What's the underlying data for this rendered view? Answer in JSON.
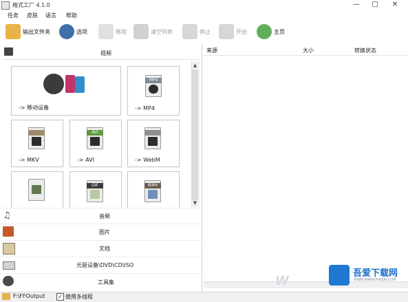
{
  "app": {
    "title": "格式工厂 4.1.0"
  },
  "window": {
    "minimize": "—",
    "maximize": "□",
    "close": "✕"
  },
  "menu": [
    "任务",
    "皮肤",
    "语言",
    "帮助"
  ],
  "toolbar": [
    {
      "label": "输出文件夹",
      "icon": "output-folder-icon",
      "enabled": true
    },
    {
      "label": "选项",
      "icon": "options-icon",
      "enabled": true
    },
    {
      "label": "移除",
      "icon": "remove-icon",
      "enabled": false
    },
    {
      "label": "清空列表",
      "icon": "clear-list-icon",
      "enabled": false
    },
    {
      "label": "停止",
      "icon": "stop-icon",
      "enabled": false
    },
    {
      "label": "开始",
      "icon": "start-icon",
      "enabled": false
    },
    {
      "label": "主页",
      "icon": "home-icon",
      "enabled": true
    }
  ],
  "video_section": {
    "label": "视频"
  },
  "tiles": [
    {
      "label": "-> 移动设备",
      "icon": "mobile-device-icon"
    },
    {
      "label": "-> MP4",
      "icon": "mp4-file-icon",
      "tag": "MP4"
    },
    {
      "label": "-> MKV",
      "icon": "mkv-file-icon",
      "tag": ""
    },
    {
      "label": "-> AVI",
      "icon": "avi-file-icon",
      "tag": "AVI"
    },
    {
      "label": "-> WebM",
      "icon": "webm-file-icon",
      "tag": ""
    },
    {
      "label": "",
      "icon": "video-file-icon",
      "tag": ""
    },
    {
      "label": "",
      "icon": "gif-file-icon",
      "tag": "GIF"
    },
    {
      "label": "",
      "icon": "wmv-file-icon",
      "tag": "WMV"
    }
  ],
  "categories": [
    {
      "label": "音频",
      "icon": "music-note-icon"
    },
    {
      "label": "图片",
      "icon": "picture-icon"
    },
    {
      "label": "文档",
      "icon": "document-icon"
    },
    {
      "label": "光驱设备\\DVD\\CD\\ISO",
      "icon": "optical-drive-icon"
    },
    {
      "label": "工具集",
      "icon": "toolbox-icon"
    }
  ],
  "task_list": {
    "columns": [
      "来源",
      "大小",
      "转换状态"
    ]
  },
  "status_bar": {
    "output_path": "F:\\FFOutput",
    "multithread_label": "使用多线程",
    "multithread_checked": "✓"
  },
  "watermark": {
    "text": "吾爱下载网",
    "sub": "WWW.WANGXIAZAI.COM",
    "mark": "W"
  }
}
